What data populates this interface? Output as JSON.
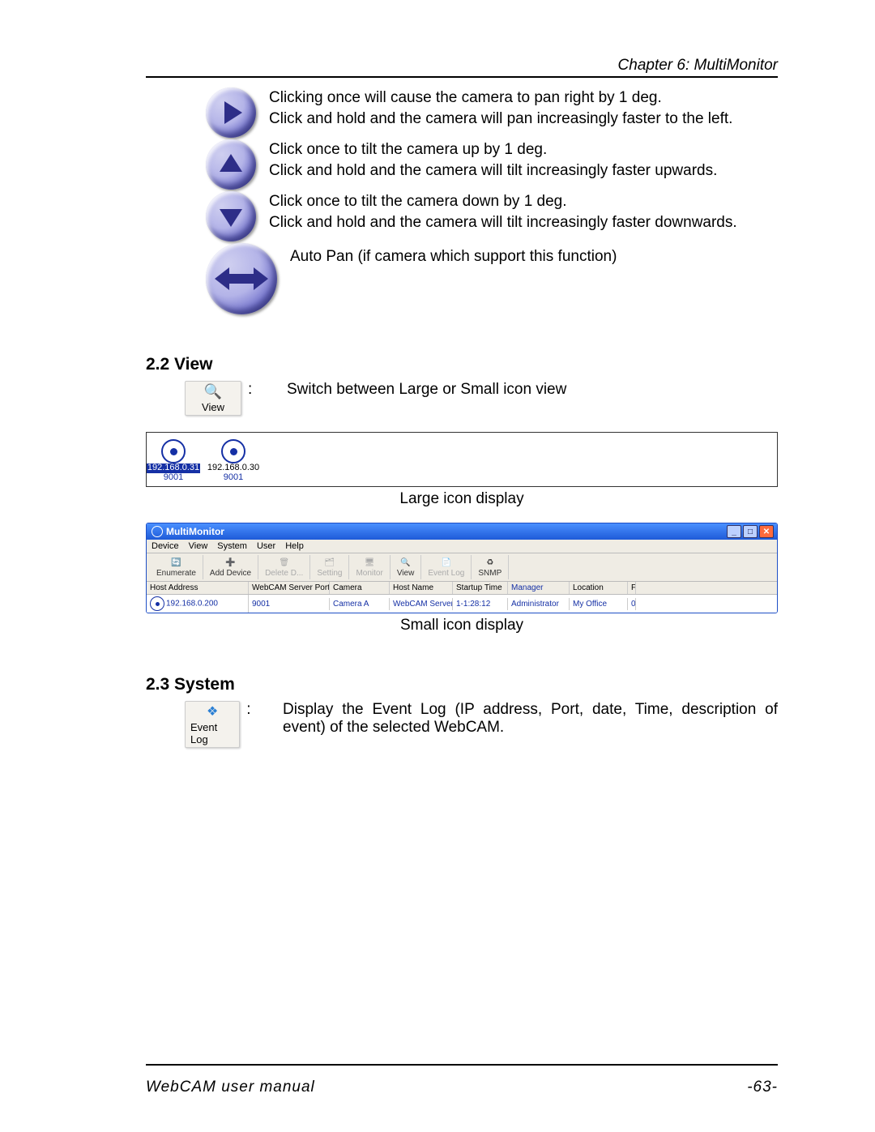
{
  "chapter": "Chapter 6: MultiMonitor",
  "controls": {
    "panRight": {
      "l1": "Clicking once will cause the camera to pan right by 1 deg.",
      "l2": "Click and hold and the camera will pan increasingly faster to the left."
    },
    "tiltUp": {
      "l1": "Click once to tilt the camera up by 1 deg.",
      "l2": "Click and hold and the camera will tilt increasingly faster upwards."
    },
    "tiltDown": {
      "l1": "Click once to tilt the camera down by 1 deg.",
      "l2": "Click and hold and the camera will tilt increasingly faster downwards."
    },
    "autoPan": {
      "l1": "Auto Pan (if camera which support this function)"
    }
  },
  "section_view_title": "2.2 View",
  "view_btn_label": "View",
  "view_desc": "Switch between Large or Small icon view",
  "largeIcons": [
    {
      "ip": "192.168.0.31",
      "port": "9001",
      "selected": true
    },
    {
      "ip": "192.168.0.30",
      "port": "9001",
      "selected": false
    }
  ],
  "caption_large": "Large icon display",
  "caption_small": "Small icon display",
  "win": {
    "title": "MultiMonitor",
    "menus": [
      "Device",
      "View",
      "System",
      "User",
      "Help"
    ],
    "toolbar": [
      {
        "label": "Enumerate"
      },
      {
        "label": "Add Device"
      },
      {
        "label": "Delete D...",
        "dim": true
      },
      {
        "label": "Setting",
        "dim": true
      },
      {
        "label": "Monitor",
        "dim": true
      },
      {
        "label": "View"
      },
      {
        "label": "Event Log",
        "dim": true
      },
      {
        "label": "SNMP"
      }
    ],
    "cols": [
      "Host Address",
      "WebCAM Server Port",
      "Camera",
      "Host Name",
      "Startup Time",
      "Manager",
      "Location",
      "F"
    ],
    "row": {
      "host": "192.168.0.200",
      "port": "9001",
      "camera": "Camera A",
      "hostname": "WebCAM Server",
      "startup": "1-1:28:12",
      "manager": "Administrator",
      "location": "My Office",
      "f": "0"
    }
  },
  "section_system_title": "2.3 System",
  "eventlog_btn_label": "Event Log",
  "eventlog_desc": "Display the Event Log (IP address, Port, date, Time, description of event) of the selected WebCAM.",
  "footer_left": "WebCAM user manual",
  "footer_right": "-63-"
}
